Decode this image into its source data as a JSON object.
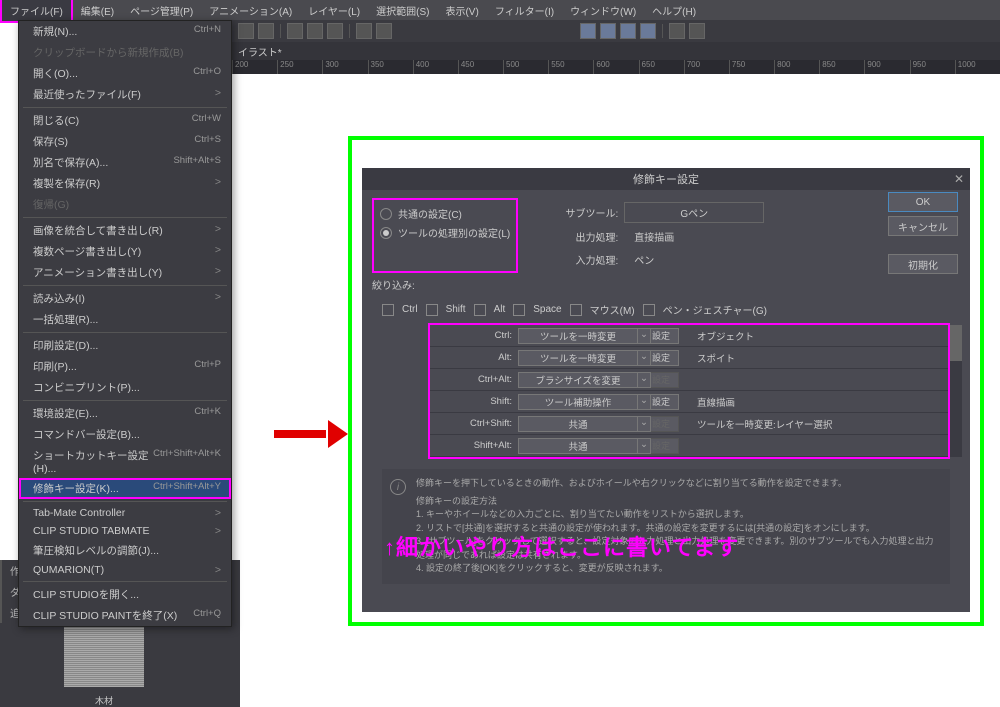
{
  "menubar": {
    "items": [
      "ファイル(F)",
      "編集(E)",
      "ページ管理(P)",
      "アニメーション(A)",
      "レイヤー(L)",
      "選択範囲(S)",
      "表示(V)",
      "フィルター(I)",
      "ウィンドウ(W)",
      "ヘルプ(H)"
    ]
  },
  "tab": {
    "name": "イラスト*"
  },
  "ruler": {
    "ticks": [
      "200",
      "250",
      "300",
      "350",
      "400",
      "450",
      "500",
      "550",
      "600",
      "650",
      "700",
      "750",
      "800",
      "850",
      "900",
      "950",
      "1000"
    ]
  },
  "file_menu": {
    "items": [
      {
        "label": "新規(N)...",
        "hotkey": "Ctrl+N"
      },
      {
        "label": "クリップボードから新規作成(B)",
        "disabled": true
      },
      {
        "label": "開く(O)...",
        "hotkey": "Ctrl+O"
      },
      {
        "label": "最近使ったファイル(F)",
        "sub": true
      },
      "sep",
      {
        "label": "閉じる(C)",
        "hotkey": "Ctrl+W"
      },
      {
        "label": "保存(S)",
        "hotkey": "Ctrl+S"
      },
      {
        "label": "別名で保存(A)...",
        "hotkey": "Shift+Alt+S"
      },
      {
        "label": "複製を保存(R)",
        "sub": true
      },
      {
        "label": "復帰(G)",
        "disabled": true
      },
      "sep",
      {
        "label": "画像を統合して書き出し(R)",
        "sub": true
      },
      {
        "label": "複数ページ書き出し(Y)",
        "sub": true
      },
      {
        "label": "アニメーション書き出し(Y)",
        "sub": true
      },
      "sep",
      {
        "label": "読み込み(I)",
        "sub": true
      },
      {
        "label": "一括処理(R)..."
      },
      "sep",
      {
        "label": "印刷設定(D)..."
      },
      {
        "label": "印刷(P)...",
        "hotkey": "Ctrl+P"
      },
      {
        "label": "コンビニプリント(P)..."
      },
      "sep",
      {
        "label": "環境設定(E)...",
        "hotkey": "Ctrl+K"
      },
      {
        "label": "コマンドバー設定(B)..."
      },
      {
        "label": "ショートカットキー設定(H)...",
        "hotkey": "Ctrl+Shift+Alt+K"
      },
      {
        "label": "修飾キー設定(K)...",
        "hotkey": "Ctrl+Shift+Alt+Y",
        "highlight": true
      },
      "sep",
      {
        "label": "Tab-Mate Controller",
        "sub": true
      },
      {
        "label": "CLIP STUDIO TABMATE",
        "sub": true
      },
      {
        "label": "筆圧検知レベルの調節(J)..."
      },
      {
        "label": "QUMARION(T)",
        "sub": true
      },
      "sep",
      {
        "label": "CLIP STUDIOを開く..."
      },
      {
        "label": "CLIP STUDIO PAINTを終了(X)",
        "hotkey": "Ctrl+Q"
      }
    ]
  },
  "left_panel": {
    "tabs": [
      "作成した素材",
      "ダウンロードした素材",
      "追加素材"
    ],
    "thumb_label": "木材"
  },
  "dialog": {
    "title": "修飾キー設定",
    "radio1": "共通の設定(C)",
    "radio2": "ツールの処理別の設定(L)",
    "subtool_label": "サブツール:",
    "subtool_value": "Gペン",
    "out_label": "出力処理:",
    "out_value": "直接描画",
    "in_label": "入力処理:",
    "in_value": "ペン",
    "filter_label": "絞り込み:",
    "filters": [
      "Ctrl",
      "Shift",
      "Alt",
      "Space",
      "マウス(M)",
      "ペン・ジェスチャー(G)"
    ],
    "buttons": {
      "ok": "OK",
      "cancel": "キャンセル",
      "init": "初期化"
    },
    "rows": [
      {
        "key": "Ctrl:",
        "action": "ツールを一時変更",
        "set": "設定",
        "value": "オブジェクト"
      },
      {
        "key": "Alt:",
        "action": "ツールを一時変更",
        "set": "設定",
        "value": "スポイト"
      },
      {
        "key": "Ctrl+Alt:",
        "action": "ブラシサイズを変更",
        "set": "設定",
        "value": "",
        "dis": true
      },
      {
        "key": "Shift:",
        "action": "ツール補助操作",
        "set": "設定",
        "value": "直線描画"
      },
      {
        "key": "Ctrl+Shift:",
        "action": "共通",
        "set": "設定",
        "value": "ツールを一時変更:レイヤー選択",
        "dis": true
      },
      {
        "key": "Shift+Alt:",
        "action": "共通",
        "set": "設定",
        "value": "",
        "dis": true
      }
    ],
    "info_top": "修飾キーを押下しているときの動作、およびホイールや右クリックなどに割り当てる動作を設定できます。",
    "info_title": "修飾キーの設定方法",
    "info_lines": [
      "1. キーやホイールなどの入力ごとに、割り当てたい動作をリストから選択します。",
      "2. リストで[共通]を選択すると共通の設定が使われます。共通の設定を変更するには[共通の設定]をオンにします。",
      "3. [サブツール]をクリックして選択すると、設定対象の入力処理と出力処理を変更できます。別のサブツールでも入力処理と出力処理が同じであれば設定は共有されます。",
      "4. 設定の終了後[OK]をクリックすると、変更が反映されます。"
    ]
  },
  "annotation": "↑細かいやり方はここに書いてます"
}
